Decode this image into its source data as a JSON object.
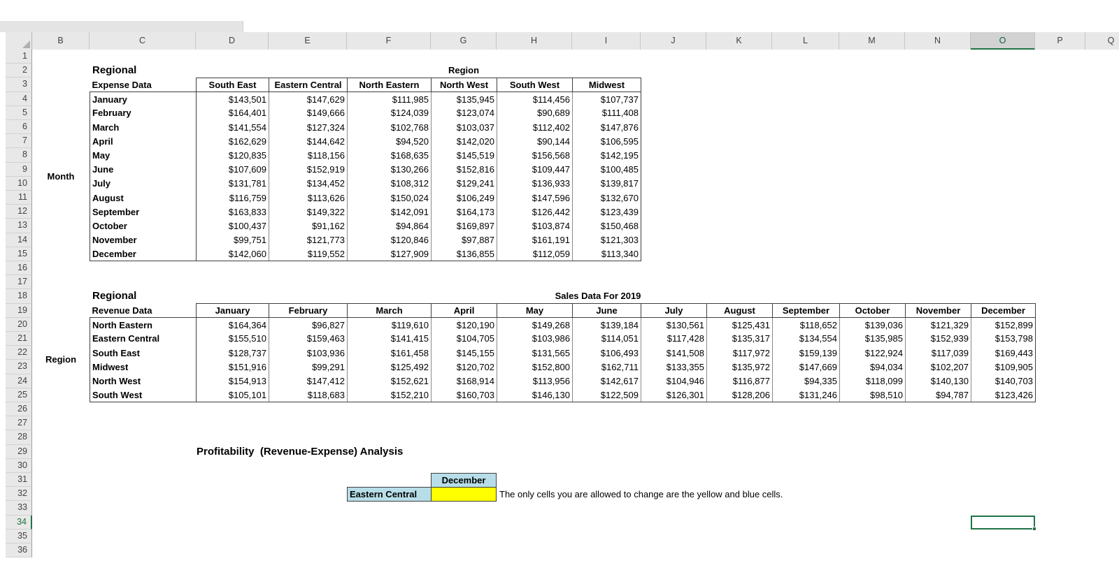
{
  "spreadsheet": {
    "column_headers": [
      "B",
      "C",
      "D",
      "E",
      "F",
      "G",
      "H",
      "I",
      "J",
      "K",
      "L",
      "M",
      "N",
      "O",
      "P",
      "Q"
    ],
    "selected_column": "O",
    "row_count": 36,
    "selected_row": 34,
    "active_cell": "O34"
  },
  "expense_table": {
    "title_top": "Regional",
    "title_bottom": "Expense Data",
    "axis_title": "Region",
    "side_axis_title": "Month",
    "column_headers": [
      "South East",
      "Eastern Central",
      "North Eastern",
      "North West",
      "South West",
      "Midwest"
    ],
    "rows": [
      {
        "label": "January",
        "values": [
          "$143,501",
          "$147,629",
          "$111,985",
          "$135,945",
          "$114,456",
          "$107,737"
        ]
      },
      {
        "label": "February",
        "values": [
          "$164,401",
          "$149,666",
          "$124,039",
          "$123,074",
          "$90,689",
          "$111,408"
        ]
      },
      {
        "label": "March",
        "values": [
          "$141,554",
          "$127,324",
          "$102,768",
          "$103,037",
          "$112,402",
          "$147,876"
        ]
      },
      {
        "label": "April",
        "values": [
          "$162,629",
          "$144,642",
          "$94,520",
          "$142,020",
          "$90,144",
          "$106,595"
        ]
      },
      {
        "label": "May",
        "values": [
          "$120,835",
          "$118,156",
          "$168,635",
          "$145,519",
          "$156,568",
          "$142,195"
        ]
      },
      {
        "label": "June",
        "values": [
          "$107,609",
          "$152,919",
          "$130,266",
          "$152,816",
          "$109,447",
          "$100,485"
        ]
      },
      {
        "label": "July",
        "values": [
          "$131,781",
          "$134,452",
          "$108,312",
          "$129,241",
          "$136,933",
          "$139,817"
        ]
      },
      {
        "label": "August",
        "values": [
          "$116,759",
          "$113,626",
          "$150,024",
          "$106,249",
          "$147,596",
          "$132,670"
        ]
      },
      {
        "label": "September",
        "values": [
          "$163,833",
          "$149,322",
          "$142,091",
          "$164,173",
          "$126,442",
          "$123,439"
        ]
      },
      {
        "label": "October",
        "values": [
          "$100,437",
          "$91,162",
          "$94,864",
          "$169,897",
          "$103,874",
          "$150,468"
        ]
      },
      {
        "label": "November",
        "values": [
          "$99,751",
          "$121,773",
          "$120,846",
          "$97,887",
          "$161,191",
          "$121,303"
        ]
      },
      {
        "label": "December",
        "values": [
          "$142,060",
          "$119,552",
          "$127,909",
          "$136,855",
          "$112,059",
          "$113,340"
        ]
      }
    ]
  },
  "revenue_table": {
    "title_top": "Regional",
    "title_bottom": "Revenue Data",
    "banner": "Sales Data For 2019",
    "side_axis_title": "Region",
    "column_headers": [
      "January",
      "February",
      "March",
      "April",
      "May",
      "June",
      "July",
      "August",
      "September",
      "October",
      "November",
      "December"
    ],
    "rows": [
      {
        "label": "North Eastern",
        "values": [
          "$164,364",
          "$96,827",
          "$119,610",
          "$120,190",
          "$149,268",
          "$139,184",
          "$130,561",
          "$125,431",
          "$118,652",
          "$139,036",
          "$121,329",
          "$152,899"
        ]
      },
      {
        "label": "Eastern Central",
        "values": [
          "$155,510",
          "$159,463",
          "$141,415",
          "$104,705",
          "$103,986",
          "$114,051",
          "$117,428",
          "$135,317",
          "$134,554",
          "$135,985",
          "$152,939",
          "$153,798"
        ]
      },
      {
        "label": "South East",
        "values": [
          "$128,737",
          "$103,936",
          "$161,458",
          "$145,155",
          "$131,565",
          "$106,493",
          "$141,508",
          "$117,972",
          "$159,139",
          "$122,924",
          "$117,039",
          "$169,443"
        ]
      },
      {
        "label": "Midwest",
        "values": [
          "$151,916",
          "$99,291",
          "$125,492",
          "$120,702",
          "$152,800",
          "$162,711",
          "$133,355",
          "$135,972",
          "$147,669",
          "$94,034",
          "$102,207",
          "$109,905"
        ]
      },
      {
        "label": "North West",
        "values": [
          "$154,913",
          "$147,412",
          "$152,621",
          "$168,914",
          "$113,956",
          "$142,617",
          "$104,946",
          "$116,877",
          "$94,335",
          "$118,099",
          "$140,130",
          "$140,703"
        ]
      },
      {
        "label": "South West",
        "values": [
          "$105,101",
          "$118,683",
          "$152,210",
          "$160,703",
          "$146,130",
          "$122,509",
          "$126,301",
          "$128,206",
          "$131,246",
          "$98,510",
          "$94,787",
          "$123,426"
        ]
      }
    ]
  },
  "analysis": {
    "title": "Profitability  (Revenue-Expense) Analysis",
    "month_cell": "December",
    "region_cell": "Eastern Central",
    "input_value": "",
    "note": "The only cells you are allowed to change are the yellow and blue cells.",
    "colors": {
      "input_yellow": "#FFFF00",
      "editable_blue": "#B7DEE8",
      "selection_green": "#217346"
    }
  }
}
